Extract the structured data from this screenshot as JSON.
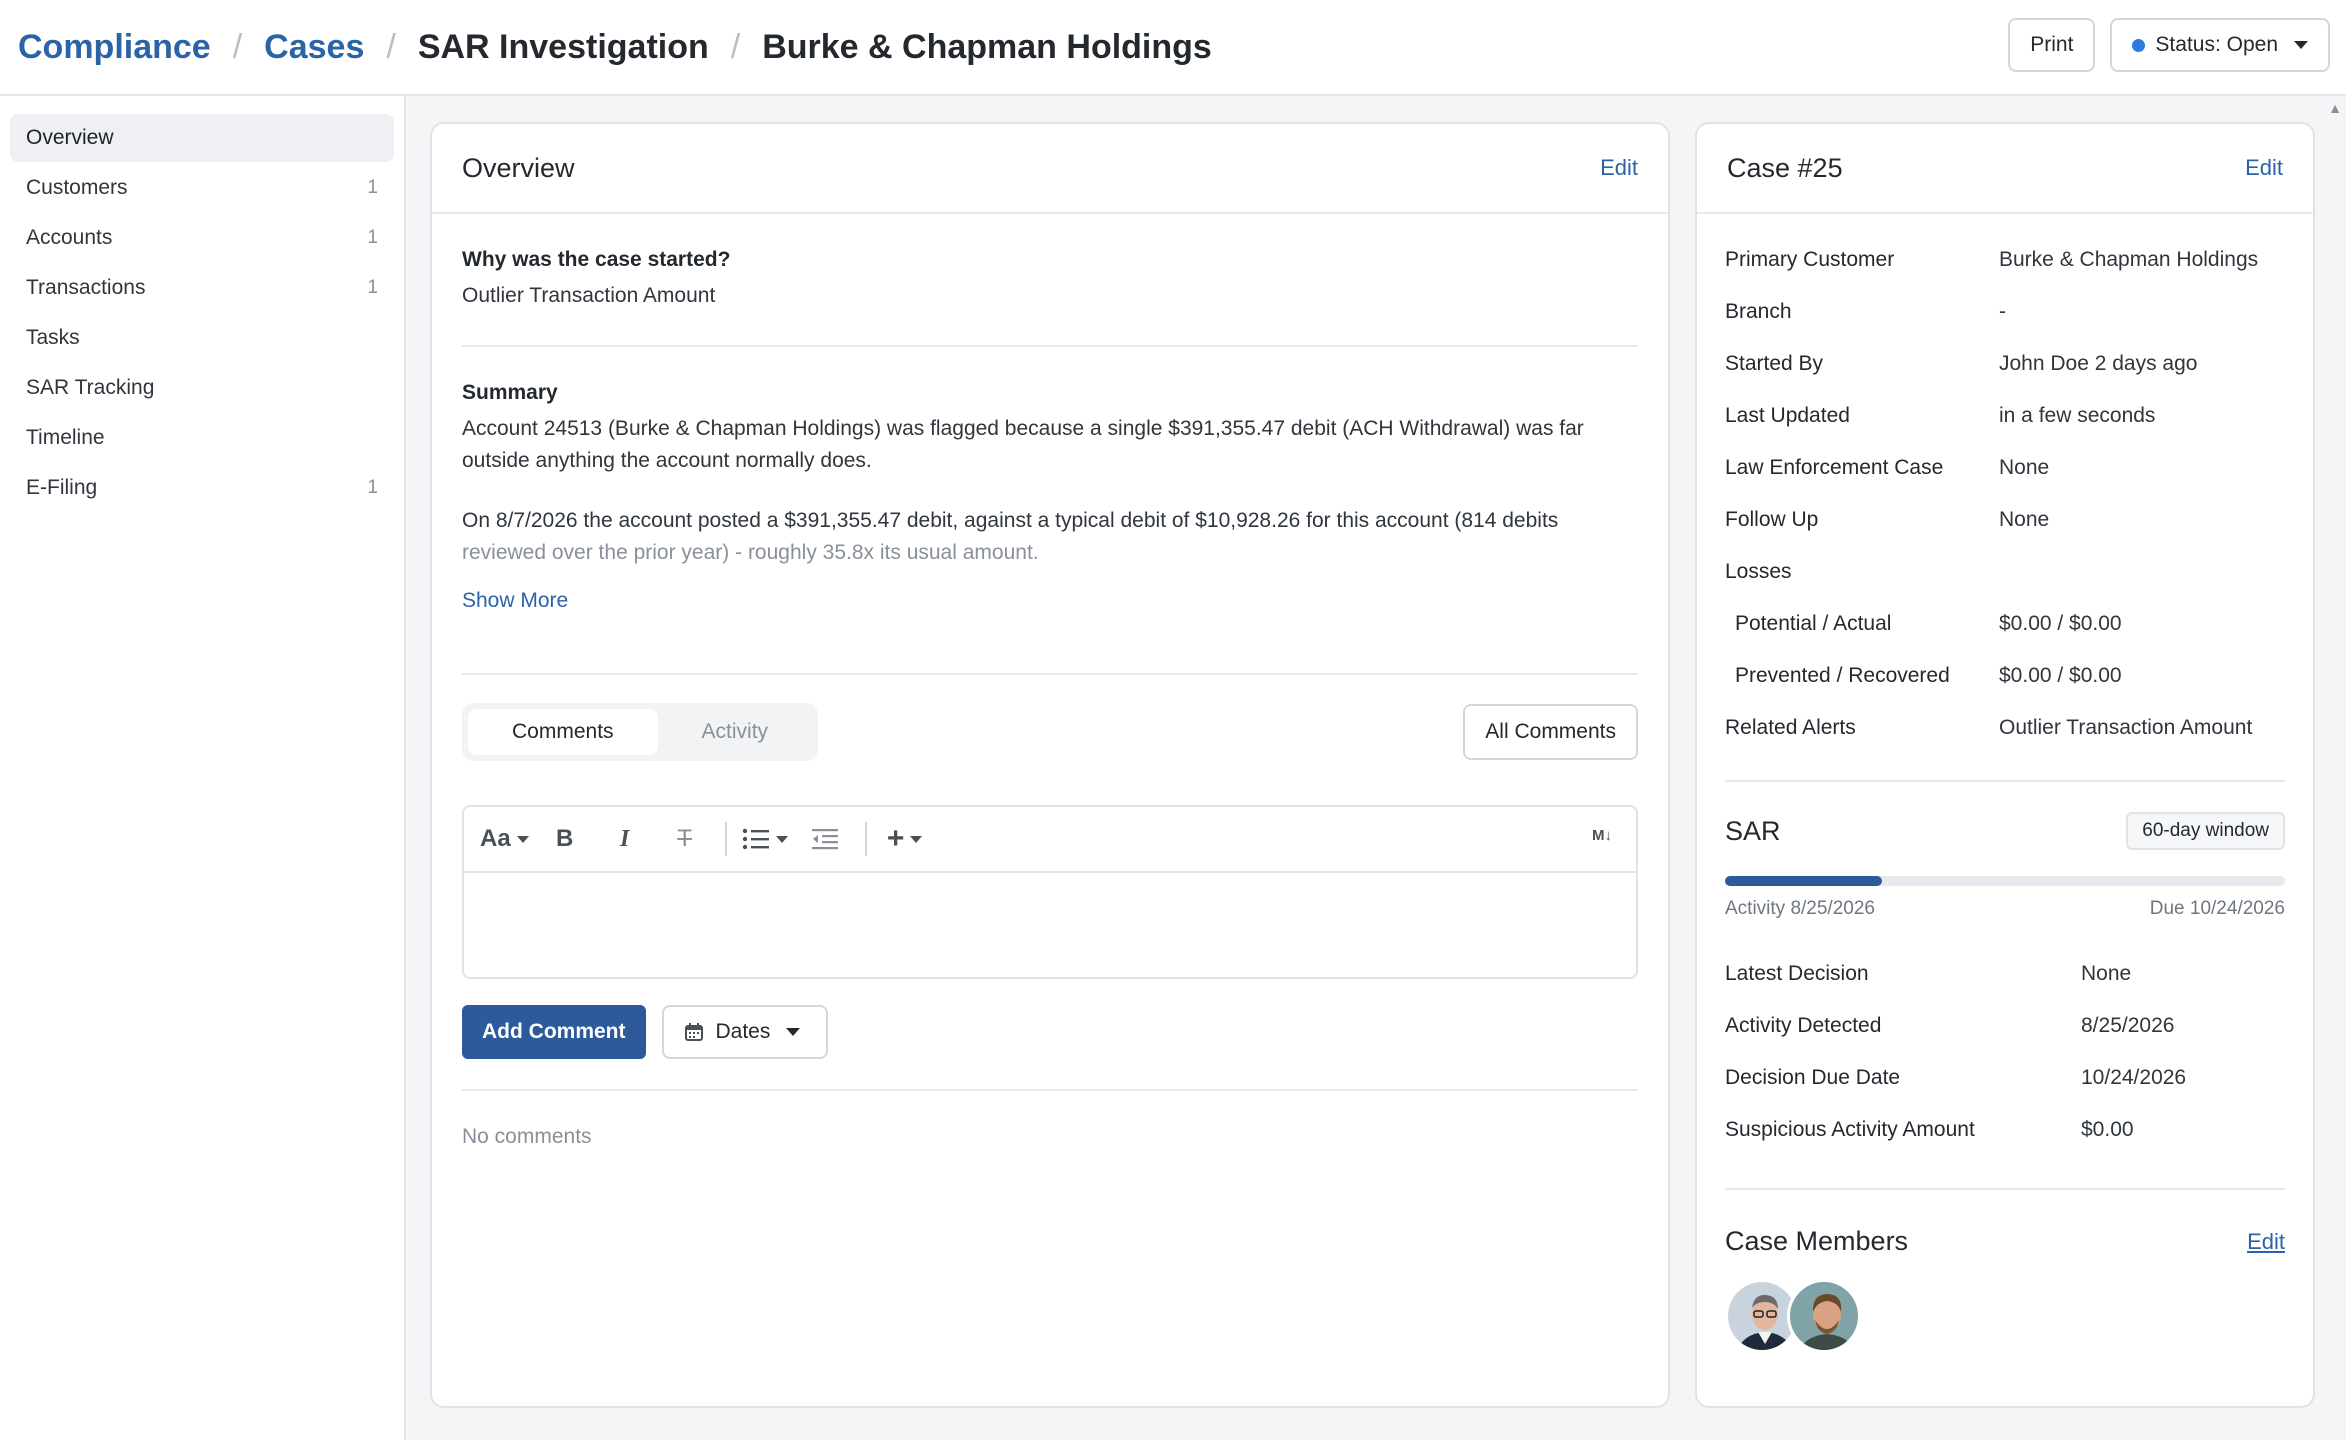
{
  "breadcrumb": [
    "Compliance",
    "Cases",
    "SAR Investigation",
    "Burke & Chapman Holdings"
  ],
  "header": {
    "print_label": "Print",
    "status_label": "Status: Open",
    "status_color": "#2e7be0"
  },
  "sidebar": {
    "items": [
      {
        "label": "Overview",
        "count": ""
      },
      {
        "label": "Customers",
        "count": "1"
      },
      {
        "label": "Accounts",
        "count": "1"
      },
      {
        "label": "Transactions",
        "count": "1"
      },
      {
        "label": "Tasks",
        "count": ""
      },
      {
        "label": "SAR Tracking",
        "count": ""
      },
      {
        "label": "Timeline",
        "count": ""
      },
      {
        "label": "E-Filing",
        "count": "1"
      }
    ]
  },
  "overview": {
    "title": "Overview",
    "edit_label": "Edit",
    "reason_label": "Why was the case started?",
    "reason_value": "Outlier Transaction Amount",
    "summary_label": "Summary",
    "summary_p1": "Account 24513 (Burke & Chapman Holdings) was flagged because a single $391,355.47 debit (ACH Withdrawal) was far outside anything the account normally does.",
    "summary_p2a": "On 8/7/2026 the account posted a $391,355.47 debit, against a typical debit of $10,928.26 for this account (814 debits",
    "summary_p2b": "reviewed over the prior year) - roughly 35.8x its usual amount.",
    "show_more": "Show More",
    "tabs": [
      "Comments",
      "Activity"
    ],
    "all_comments": "All Comments",
    "add_comment": "Add Comment",
    "dates_label": "Dates",
    "no_comments": "No comments",
    "toolbar": {
      "font": "Aa",
      "bold": "B",
      "italic": "I",
      "strike": "T",
      "md": "M↓"
    }
  },
  "case": {
    "title": "Case #25",
    "edit_label": "Edit",
    "fields": [
      {
        "k": "Primary Customer",
        "v": "Burke & Chapman Holdings"
      },
      {
        "k": "Branch",
        "v": "-"
      },
      {
        "k": "Started By",
        "v": "John Doe 2 days ago"
      },
      {
        "k": "Last Updated",
        "v": "in a few seconds"
      },
      {
        "k": "Law Enforcement Case",
        "v": "None"
      },
      {
        "k": "Follow Up",
        "v": "None"
      }
    ],
    "losses_label": "Losses",
    "losses": [
      {
        "k": "Potential / Actual",
        "v": "$0.00 / $0.00"
      },
      {
        "k": "Prevented / Recovered",
        "v": "$0.00 / $0.00"
      }
    ],
    "related_alerts_label": "Related Alerts",
    "related_alerts_value": "Outlier Transaction Amount",
    "sar": {
      "title": "SAR",
      "window_badge": "60-day window",
      "progress": 0.28,
      "activity_label": "Activity 8/25/2026",
      "due_label": "Due 10/24/2026",
      "fields": [
        {
          "k": "Latest Decision",
          "v": "None"
        },
        {
          "k": "Activity Detected",
          "v": "8/25/2026"
        },
        {
          "k": "Decision Due Date",
          "v": "10/24/2026"
        },
        {
          "k": "Suspicious Activity Amount",
          "v": "$0.00"
        }
      ]
    },
    "members_title": "Case Members",
    "members_edit": "Edit"
  }
}
